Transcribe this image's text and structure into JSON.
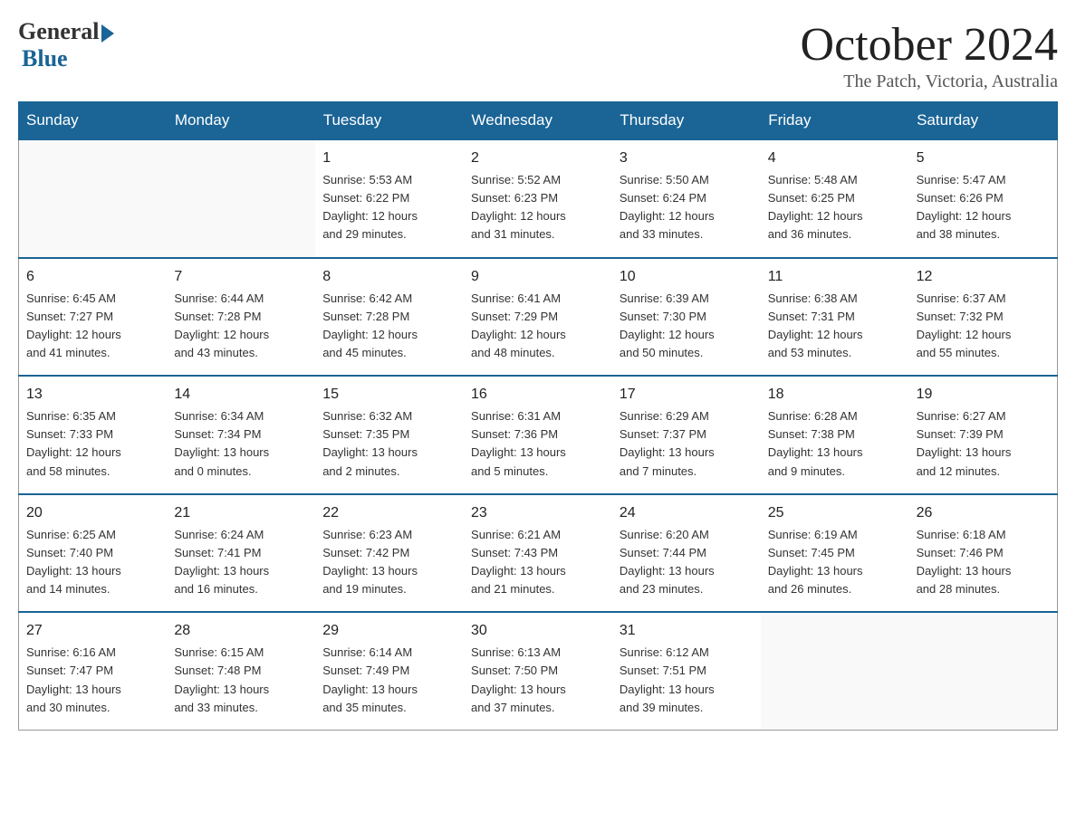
{
  "header": {
    "logo_general": "General",
    "logo_blue": "Blue",
    "month_title": "October 2024",
    "location": "The Patch, Victoria, Australia"
  },
  "days_of_week": [
    "Sunday",
    "Monday",
    "Tuesday",
    "Wednesday",
    "Thursday",
    "Friday",
    "Saturday"
  ],
  "weeks": [
    [
      {
        "day": "",
        "info": ""
      },
      {
        "day": "",
        "info": ""
      },
      {
        "day": "1",
        "info": "Sunrise: 5:53 AM\nSunset: 6:22 PM\nDaylight: 12 hours\nand 29 minutes."
      },
      {
        "day": "2",
        "info": "Sunrise: 5:52 AM\nSunset: 6:23 PM\nDaylight: 12 hours\nand 31 minutes."
      },
      {
        "day": "3",
        "info": "Sunrise: 5:50 AM\nSunset: 6:24 PM\nDaylight: 12 hours\nand 33 minutes."
      },
      {
        "day": "4",
        "info": "Sunrise: 5:48 AM\nSunset: 6:25 PM\nDaylight: 12 hours\nand 36 minutes."
      },
      {
        "day": "5",
        "info": "Sunrise: 5:47 AM\nSunset: 6:26 PM\nDaylight: 12 hours\nand 38 minutes."
      }
    ],
    [
      {
        "day": "6",
        "info": "Sunrise: 6:45 AM\nSunset: 7:27 PM\nDaylight: 12 hours\nand 41 minutes."
      },
      {
        "day": "7",
        "info": "Sunrise: 6:44 AM\nSunset: 7:28 PM\nDaylight: 12 hours\nand 43 minutes."
      },
      {
        "day": "8",
        "info": "Sunrise: 6:42 AM\nSunset: 7:28 PM\nDaylight: 12 hours\nand 45 minutes."
      },
      {
        "day": "9",
        "info": "Sunrise: 6:41 AM\nSunset: 7:29 PM\nDaylight: 12 hours\nand 48 minutes."
      },
      {
        "day": "10",
        "info": "Sunrise: 6:39 AM\nSunset: 7:30 PM\nDaylight: 12 hours\nand 50 minutes."
      },
      {
        "day": "11",
        "info": "Sunrise: 6:38 AM\nSunset: 7:31 PM\nDaylight: 12 hours\nand 53 minutes."
      },
      {
        "day": "12",
        "info": "Sunrise: 6:37 AM\nSunset: 7:32 PM\nDaylight: 12 hours\nand 55 minutes."
      }
    ],
    [
      {
        "day": "13",
        "info": "Sunrise: 6:35 AM\nSunset: 7:33 PM\nDaylight: 12 hours\nand 58 minutes."
      },
      {
        "day": "14",
        "info": "Sunrise: 6:34 AM\nSunset: 7:34 PM\nDaylight: 13 hours\nand 0 minutes."
      },
      {
        "day": "15",
        "info": "Sunrise: 6:32 AM\nSunset: 7:35 PM\nDaylight: 13 hours\nand 2 minutes."
      },
      {
        "day": "16",
        "info": "Sunrise: 6:31 AM\nSunset: 7:36 PM\nDaylight: 13 hours\nand 5 minutes."
      },
      {
        "day": "17",
        "info": "Sunrise: 6:29 AM\nSunset: 7:37 PM\nDaylight: 13 hours\nand 7 minutes."
      },
      {
        "day": "18",
        "info": "Sunrise: 6:28 AM\nSunset: 7:38 PM\nDaylight: 13 hours\nand 9 minutes."
      },
      {
        "day": "19",
        "info": "Sunrise: 6:27 AM\nSunset: 7:39 PM\nDaylight: 13 hours\nand 12 minutes."
      }
    ],
    [
      {
        "day": "20",
        "info": "Sunrise: 6:25 AM\nSunset: 7:40 PM\nDaylight: 13 hours\nand 14 minutes."
      },
      {
        "day": "21",
        "info": "Sunrise: 6:24 AM\nSunset: 7:41 PM\nDaylight: 13 hours\nand 16 minutes."
      },
      {
        "day": "22",
        "info": "Sunrise: 6:23 AM\nSunset: 7:42 PM\nDaylight: 13 hours\nand 19 minutes."
      },
      {
        "day": "23",
        "info": "Sunrise: 6:21 AM\nSunset: 7:43 PM\nDaylight: 13 hours\nand 21 minutes."
      },
      {
        "day": "24",
        "info": "Sunrise: 6:20 AM\nSunset: 7:44 PM\nDaylight: 13 hours\nand 23 minutes."
      },
      {
        "day": "25",
        "info": "Sunrise: 6:19 AM\nSunset: 7:45 PM\nDaylight: 13 hours\nand 26 minutes."
      },
      {
        "day": "26",
        "info": "Sunrise: 6:18 AM\nSunset: 7:46 PM\nDaylight: 13 hours\nand 28 minutes."
      }
    ],
    [
      {
        "day": "27",
        "info": "Sunrise: 6:16 AM\nSunset: 7:47 PM\nDaylight: 13 hours\nand 30 minutes."
      },
      {
        "day": "28",
        "info": "Sunrise: 6:15 AM\nSunset: 7:48 PM\nDaylight: 13 hours\nand 33 minutes."
      },
      {
        "day": "29",
        "info": "Sunrise: 6:14 AM\nSunset: 7:49 PM\nDaylight: 13 hours\nand 35 minutes."
      },
      {
        "day": "30",
        "info": "Sunrise: 6:13 AM\nSunset: 7:50 PM\nDaylight: 13 hours\nand 37 minutes."
      },
      {
        "day": "31",
        "info": "Sunrise: 6:12 AM\nSunset: 7:51 PM\nDaylight: 13 hours\nand 39 minutes."
      },
      {
        "day": "",
        "info": ""
      },
      {
        "day": "",
        "info": ""
      }
    ]
  ]
}
